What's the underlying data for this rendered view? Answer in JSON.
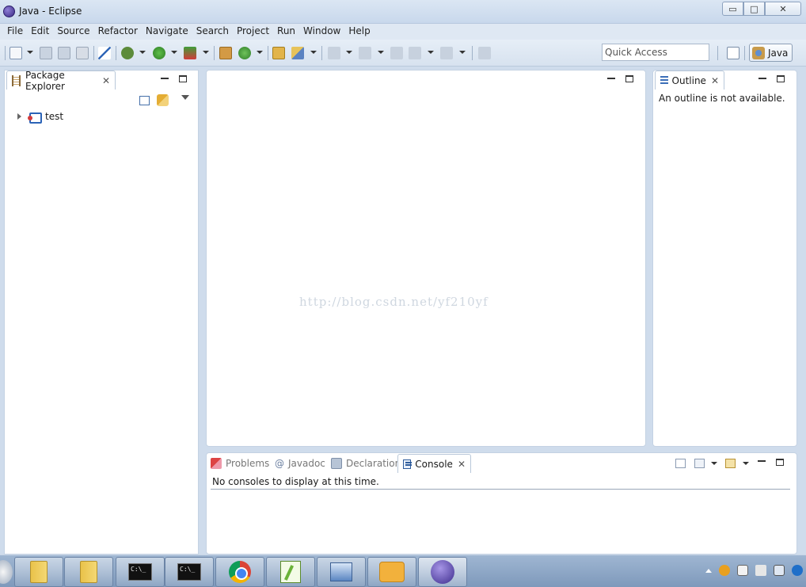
{
  "window": {
    "title": "Java - Eclipse",
    "min": "▭",
    "max": "□",
    "close": "✕"
  },
  "menu": [
    "File",
    "Edit",
    "Source",
    "Refactor",
    "Navigate",
    "Search",
    "Project",
    "Run",
    "Window",
    "Help"
  ],
  "toolbar": {
    "quick_access_placeholder": "Quick Access",
    "perspective_label": "Java",
    "icons": [
      "new-wizard-icon",
      "save-icon",
      "save-all-icon",
      "print-icon",
      "skip-breakpoints-icon",
      "debug-icon",
      "run-icon",
      "coverage-icon",
      "new-java-project-icon",
      "new-class-icon",
      "open-type-icon",
      "search-icon",
      "next-annotation-icon",
      "previous-annotation-icon",
      "last-edit-icon",
      "back-icon",
      "forward-icon",
      "pin-editor-icon",
      "open-perspective-icon"
    ]
  },
  "package_explorer": {
    "tab_label": "Package Explorer",
    "close_glyph": "✕",
    "items": [
      {
        "label": "test",
        "icon": "java-project-icon"
      }
    ]
  },
  "outline": {
    "tab_label": "Outline",
    "close_glyph": "✕",
    "message": "An outline is not available."
  },
  "bottom": {
    "tabs": [
      {
        "label": "Problems",
        "active": false,
        "icon": "problems-icon"
      },
      {
        "label": "Javadoc",
        "active": false,
        "icon": "javadoc-icon"
      },
      {
        "label": "Declaration",
        "active": false,
        "icon": "declaration-icon"
      },
      {
        "label": "Console",
        "active": true,
        "icon": "console-icon"
      }
    ],
    "console_close_glyph": "✕",
    "javadoc_glyph": "@",
    "console_message": "No consoles to display at this time."
  },
  "watermark": "http://blog.csdn.net/yf210yf",
  "taskbar": {
    "cmd_text": "C:\\_",
    "apps": [
      "explorer",
      "explorer",
      "command-prompt",
      "command-prompt",
      "chrome",
      "notepad++",
      "network",
      "messenger",
      "eclipse"
    ]
  }
}
